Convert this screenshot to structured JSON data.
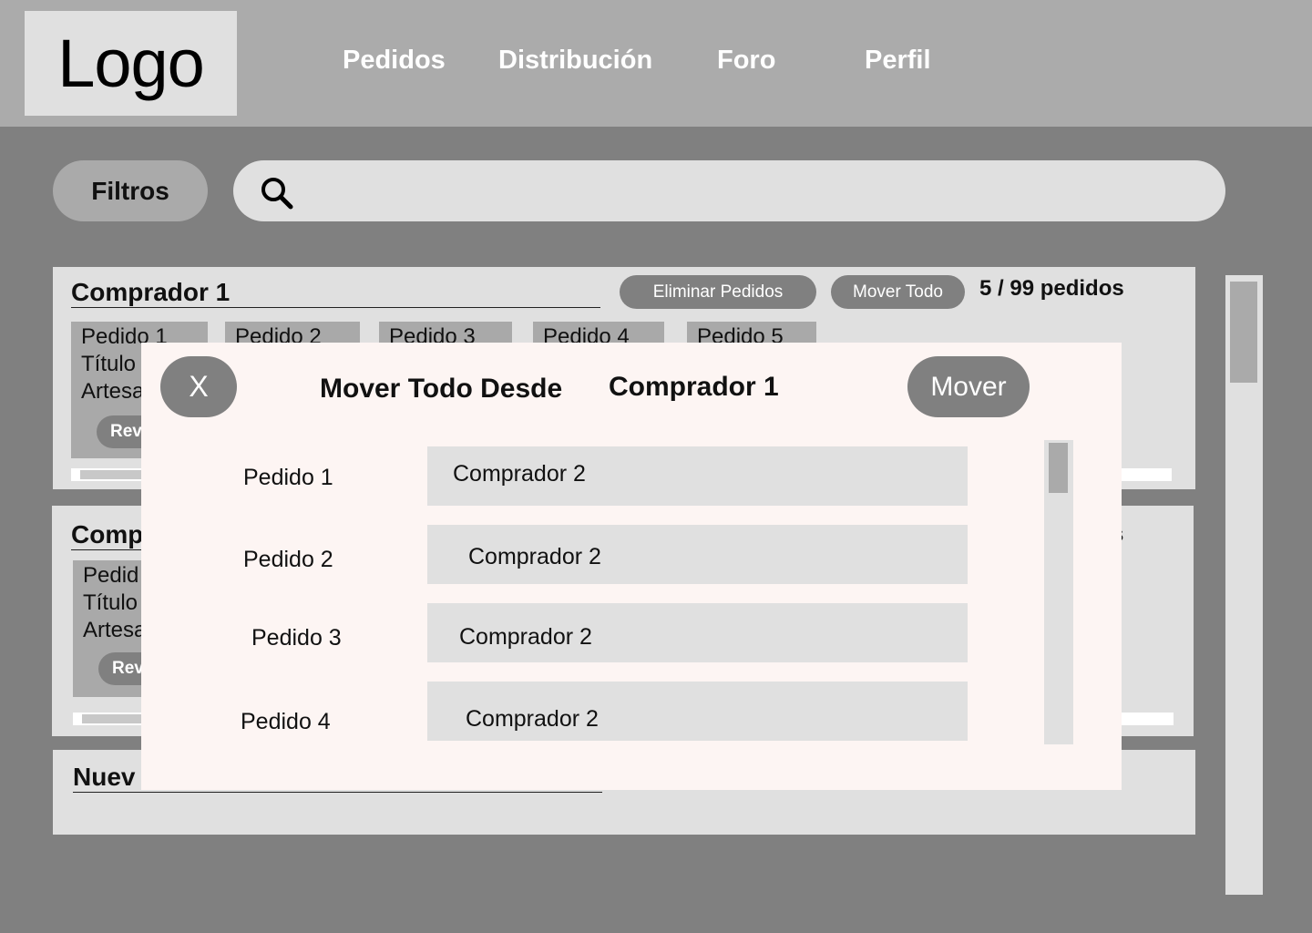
{
  "header": {
    "logo": "Logo",
    "nav": [
      "Pedidos",
      "Distribución",
      "Foro",
      "Perfil"
    ]
  },
  "toolbar": {
    "filters_label": "Filtros",
    "search_placeholder": ""
  },
  "cards": [
    {
      "title": "Comprador 1",
      "delete_label": "Eliminar Pedidos",
      "move_all_label": "Mover Todo",
      "count": "5 / 99 pedidos",
      "orders": [
        "Pedido 1",
        "Pedido 2",
        "Pedido 3",
        "Pedido 4",
        "Pedido 5"
      ],
      "first_order_lines": [
        "Pedido 1",
        "Título",
        "Artesa"
      ],
      "review_label": "Rev"
    },
    {
      "title": "Comp",
      "count_fragment": "s",
      "first_order_lines": [
        "Pedid",
        "Título",
        "Artesa"
      ],
      "review_label": "Rev"
    },
    {
      "title": "Nuev"
    }
  ],
  "modal": {
    "close_label": "X",
    "title": "Mover Todo Desde",
    "source": "Comprador 1",
    "move_label": "Mover",
    "rows": [
      {
        "order": "Pedido 1",
        "target": "Comprador 2"
      },
      {
        "order": "Pedido 2",
        "target": "Comprador 2"
      },
      {
        "order": "Pedido 3",
        "target": "Comprador 2"
      },
      {
        "order": "Pedido 4",
        "target": "Comprador 2"
      }
    ]
  },
  "colors": {
    "background": "#808080",
    "header": "#ababab",
    "panel": "#e0e0e0",
    "modal": "#fdf5f3",
    "button": "#808080"
  }
}
